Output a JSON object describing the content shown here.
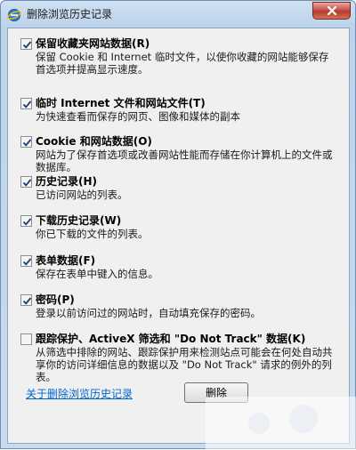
{
  "window": {
    "title": "删除浏览历史记录"
  },
  "items": [
    {
      "label": "保留收藏夹网站数据(R)",
      "desc": "保留 Cookie 和 Internet 临时文件，以使你收藏的网站能够保存首选项并提高显示速度。",
      "checked": true
    },
    {
      "label": "临时 Internet 文件和网站文件(T)",
      "desc": "为快速查看而保存的网页、图像和媒体的副本",
      "checked": true
    },
    {
      "label": "Cookie 和网站数据(O)",
      "desc": "网站为了保存首选项或改善网站性能而存储在你计算机上的文件或数据库。",
      "checked": true
    },
    {
      "label": "历史记录(H)",
      "desc": "已访问网站的列表。",
      "checked": true
    },
    {
      "label": "下载历史记录(W)",
      "desc": "你已下载的文件的列表。",
      "checked": true
    },
    {
      "label": "表单数据(F)",
      "desc": "保存在表单中键入的信息。",
      "checked": true
    },
    {
      "label": "密码(P)",
      "desc": "登录以前访问过的网站时，自动填充保存的密码。",
      "checked": true
    },
    {
      "label": "跟踪保护、ActiveX 筛选和 \"Do Not Track\" 数据(K)",
      "desc": "从筛选中排除的网站、跟踪保护用来检测站点可能会在何处自动共享你的访问详细信息的数据以及 \"Do Not Track\" 请求的例外的列表。",
      "checked": false
    }
  ],
  "footer": {
    "about_link": "关于删除浏览历史记录",
    "delete_button": "删除"
  }
}
